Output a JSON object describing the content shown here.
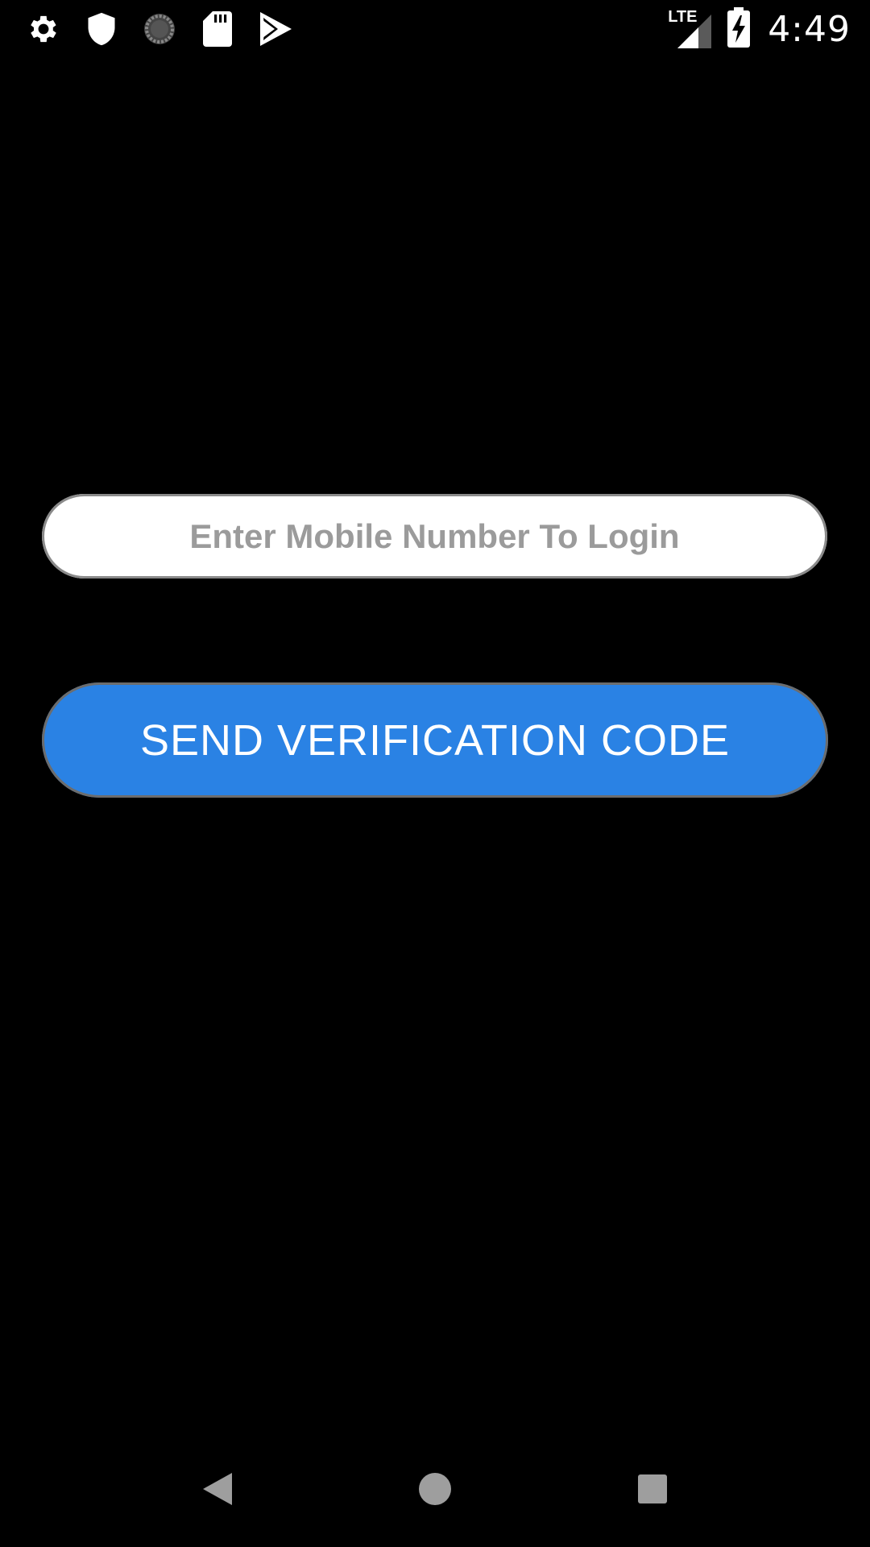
{
  "status_bar": {
    "time": "4:49",
    "network": "LTE",
    "left_icons": [
      "gear-icon",
      "shield-icon",
      "sync-spinner-icon",
      "sd-card-icon",
      "play-store-icon"
    ],
    "right_icons": [
      "lte-signal-icon",
      "battery-charging-icon"
    ]
  },
  "login": {
    "phone_placeholder": "Enter Mobile Number To Login",
    "phone_value": "",
    "send_button_label": "SEND VERIFICATION CODE"
  },
  "nav_bar": {
    "icons": [
      "back-icon",
      "home-icon",
      "recents-icon"
    ]
  },
  "colors": {
    "background": "#000000",
    "accent": "#2a82e4",
    "input_bg": "#ffffff",
    "placeholder": "#9b9b9b"
  }
}
